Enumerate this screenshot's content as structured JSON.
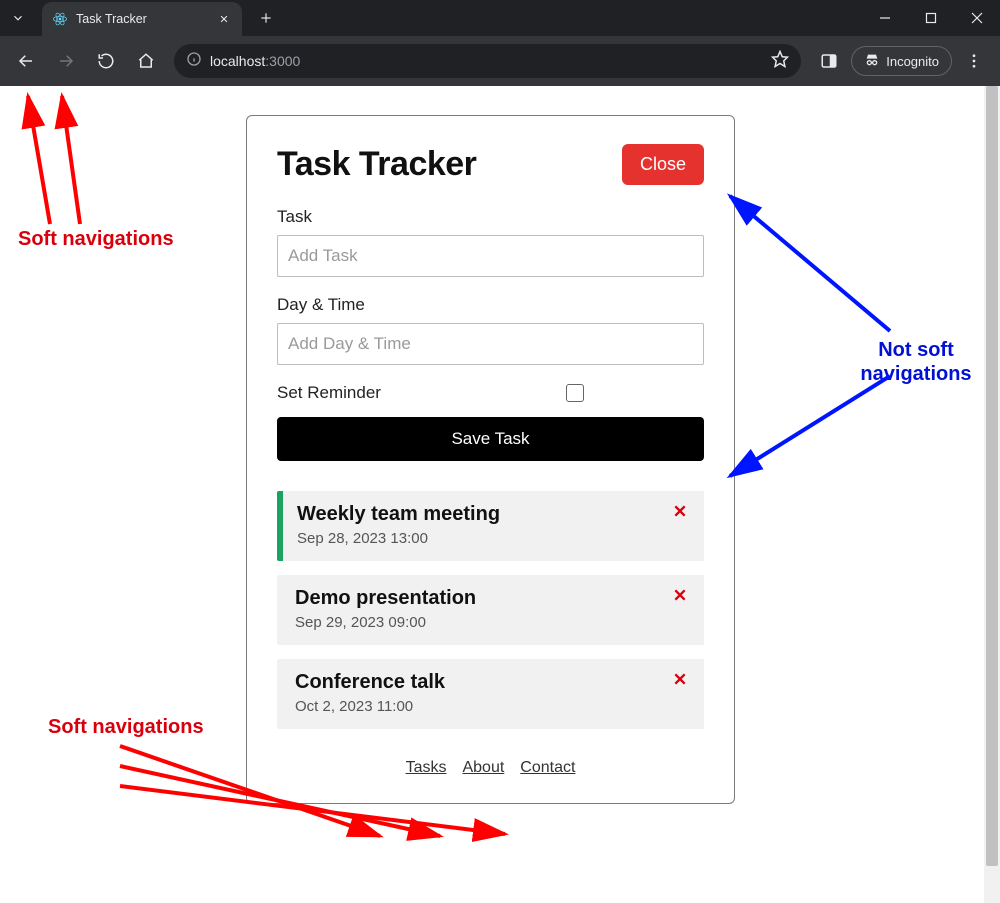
{
  "browser": {
    "tab_title": "Task Tracker",
    "url_host": "localhost",
    "url_port": ":3000",
    "incognito_label": "Incognito"
  },
  "app": {
    "title": "Task Tracker",
    "close_label": "Close",
    "form": {
      "task_label": "Task",
      "task_placeholder": "Add Task",
      "day_label": "Day & Time",
      "day_placeholder": "Add Day & Time",
      "reminder_label": "Set Reminder",
      "save_label": "Save Task"
    },
    "tasks": [
      {
        "title": "Weekly team meeting",
        "day": "Sep 28, 2023 13:00",
        "reminder": true
      },
      {
        "title": "Demo presentation",
        "day": "Sep 29, 2023 09:00",
        "reminder": false
      },
      {
        "title": "Conference talk",
        "day": "Oct 2, 2023 11:00",
        "reminder": false
      }
    ],
    "footer": {
      "tasks": "Tasks",
      "about": "About",
      "contact": "Contact"
    }
  },
  "annotations": {
    "soft_nav_top": "Soft navigations",
    "not_soft_nav": "Not soft navigations",
    "soft_nav_bottom": "Soft navigations"
  },
  "colors": {
    "accent_red": "#e6322f",
    "accent_green": "#1aa260",
    "anno_red": "#d8000c",
    "anno_blue": "#0015ff"
  }
}
